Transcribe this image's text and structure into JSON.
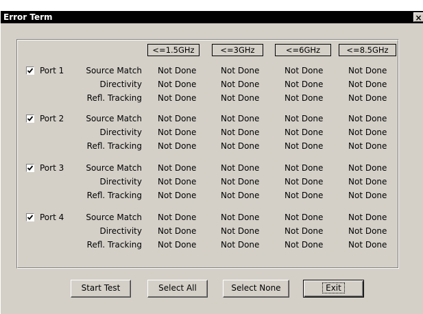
{
  "window": {
    "title": "Error Term",
    "close_label": "×"
  },
  "headers": [
    "<=1.5GHz",
    "<=3GHz",
    "<=6GHz",
    "<=8.5GHz"
  ],
  "ports": [
    {
      "label": "Port 1",
      "checked": true,
      "terms": [
        {
          "label": "Source Match",
          "values": [
            "Not Done",
            "Not Done",
            "Not Done",
            "Not Done"
          ]
        },
        {
          "label": "Directivity",
          "values": [
            "Not Done",
            "Not Done",
            "Not Done",
            "Not Done"
          ]
        },
        {
          "label": "Refl. Tracking",
          "values": [
            "Not Done",
            "Not Done",
            "Not Done",
            "Not Done"
          ]
        }
      ]
    },
    {
      "label": "Port 2",
      "checked": true,
      "terms": [
        {
          "label": "Source Match",
          "values": [
            "Not Done",
            "Not Done",
            "Not Done",
            "Not Done"
          ]
        },
        {
          "label": "Directivity",
          "values": [
            "Not Done",
            "Not Done",
            "Not Done",
            "Not Done"
          ]
        },
        {
          "label": "Refl. Tracking",
          "values": [
            "Not Done",
            "Not Done",
            "Not Done",
            "Not Done"
          ]
        }
      ]
    },
    {
      "label": "Port 3",
      "checked": true,
      "terms": [
        {
          "label": "Source Match",
          "values": [
            "Not Done",
            "Not Done",
            "Not Done",
            "Not Done"
          ]
        },
        {
          "label": "Directivity",
          "values": [
            "Not Done",
            "Not Done",
            "Not Done",
            "Not Done"
          ]
        },
        {
          "label": "Refl. Tracking",
          "values": [
            "Not Done",
            "Not Done",
            "Not Done",
            "Not Done"
          ]
        }
      ]
    },
    {
      "label": "Port 4",
      "checked": true,
      "terms": [
        {
          "label": "Source Match",
          "values": [
            "Not Done",
            "Not Done",
            "Not Done",
            "Not Done"
          ]
        },
        {
          "label": "Directivity",
          "values": [
            "Not Done",
            "Not Done",
            "Not Done",
            "Not Done"
          ]
        },
        {
          "label": "Refl. Tracking",
          "values": [
            "Not Done",
            "Not Done",
            "Not Done",
            "Not Done"
          ]
        }
      ]
    }
  ],
  "buttons": {
    "start_test": "Start Test",
    "select_all": "Select All",
    "select_none": "Select None",
    "exit": "Exit"
  }
}
